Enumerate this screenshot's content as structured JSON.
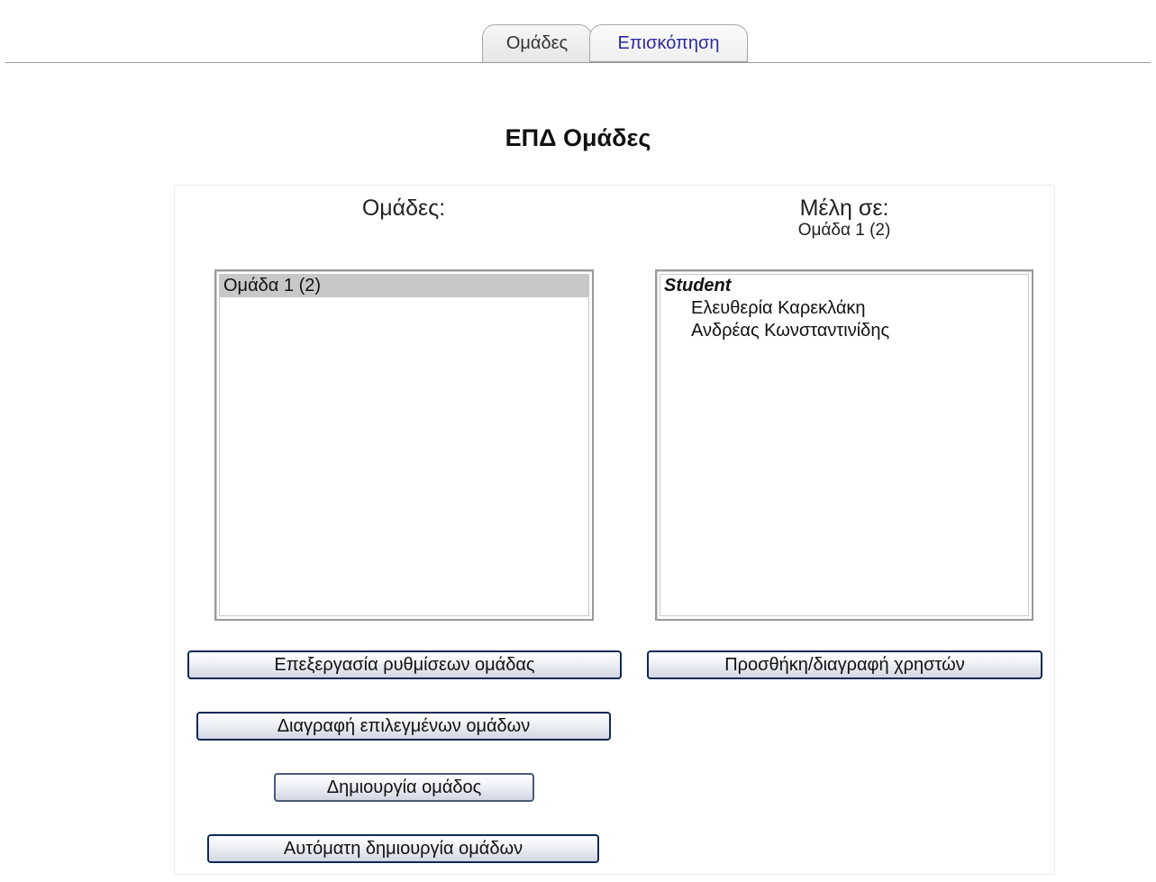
{
  "tabs": [
    {
      "label": "Ομάδες",
      "active": true
    },
    {
      "label": "Επισκόπηση",
      "active": false
    }
  ],
  "page_title": "ΕΠΔ Ομάδες",
  "groups_column": {
    "heading": "Ομάδες:",
    "options": [
      {
        "label": "Ομάδα 1 (2)",
        "selected": true
      }
    ]
  },
  "members_column": {
    "heading": "Μέλη σε:",
    "subheading": "Ομάδα 1 (2)",
    "role_label": "Student",
    "members": [
      "Ελευθερία Καρεκλάκη",
      "Ανδρέας Κωνσταντινίδης"
    ]
  },
  "buttons": {
    "edit_group_settings": "Επεξεργασία ρυθμίσεων ομάδας",
    "add_remove_users": "Προσθήκη/διαγραφή χρηστών",
    "delete_selected_groups": "Διαγραφή επιλεγμένων ομάδων",
    "create_group": "Δημιουργία ομάδος",
    "auto_create_groups": "Αυτόματη δημιουργία ομάδων"
  },
  "colors": {
    "button_border": "#0f2a55",
    "selected_option_bg": "#c8c8c8",
    "link_tab_text": "#2a2a9f"
  }
}
